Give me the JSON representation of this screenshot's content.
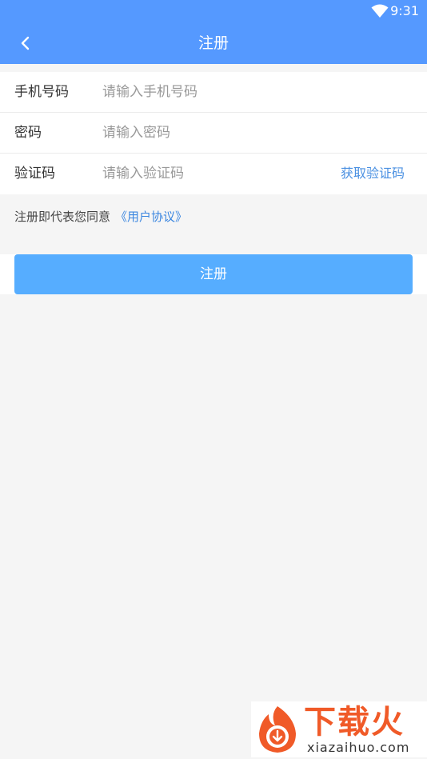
{
  "status_bar": {
    "time": "9:31",
    "wifi_icon": "wifi-icon"
  },
  "app_bar": {
    "title": "注册",
    "back_icon": "chevron-left-icon"
  },
  "form": {
    "phone": {
      "label": "手机号码",
      "placeholder": "请输入手机号码"
    },
    "password": {
      "label": "密码",
      "placeholder": "请输入密码"
    },
    "code": {
      "label": "验证码",
      "placeholder": "请输入验证码",
      "get_code": "获取验证码"
    }
  },
  "agreement": {
    "text": "注册即代表您同意",
    "link": "《用户协议》"
  },
  "submit_label": "注册",
  "watermark": {
    "brand": "下载火",
    "domain": "xiazaihuo.com"
  },
  "colors": {
    "primary": "#5599ff",
    "button": "#56adff",
    "link": "#4a90e2",
    "watermark": "#f05a28"
  }
}
